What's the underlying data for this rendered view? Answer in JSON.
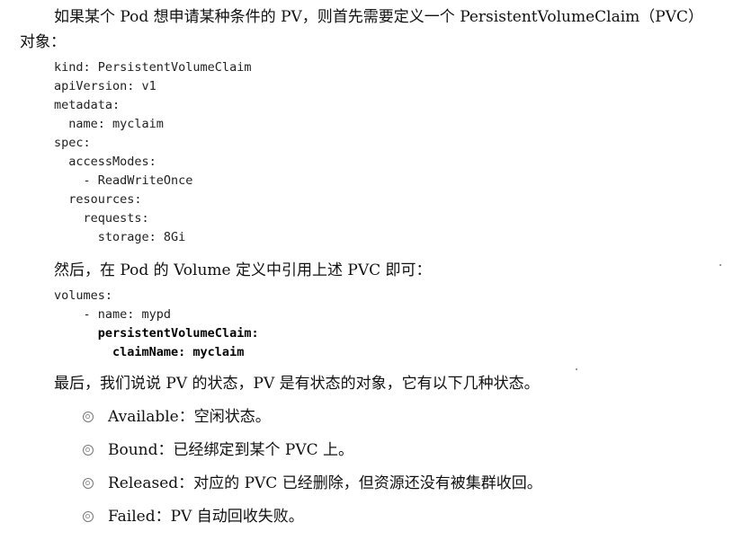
{
  "intro": {
    "line1": "如果某个 Pod 想申请某种条件的 PV，则首先需要定义一个 PersistentVolumeClaim（PVC）",
    "line2": "对象："
  },
  "pvc_yaml": [
    "kind: PersistentVolumeClaim",
    "apiVersion: v1",
    "metadata:",
    "  name: myclaim",
    "spec:",
    "  accessModes:",
    "    - ReadWriteOnce",
    "  resources:",
    "    requests:",
    "      storage: 8Gi"
  ],
  "volume_intro": "然后，在 Pod 的 Volume 定义中引用上述 PVC 即可：",
  "volume_yaml": {
    "line1": "volumes:",
    "line2": "    - name: mypd",
    "line3": "      persistentVolumeClaim:",
    "line4": "        claimName: myclaim"
  },
  "status_intro": "最后，我们说说 PV 的状态，PV 是有状态的对象，它有以下几种状态。",
  "states": [
    {
      "name": "Available",
      "desc": "：空闲状态。"
    },
    {
      "name": "Bound",
      "desc": "：已经绑定到某个 PVC 上。"
    },
    {
      "name": "Released",
      "desc": "：对应的 PVC 已经删除，但资源还没有被集群收回。"
    },
    {
      "name": "Failed",
      "desc": "：PV 自动回收失败。"
    }
  ],
  "icons": {
    "bullet": "double-circle-bullet-icon"
  }
}
